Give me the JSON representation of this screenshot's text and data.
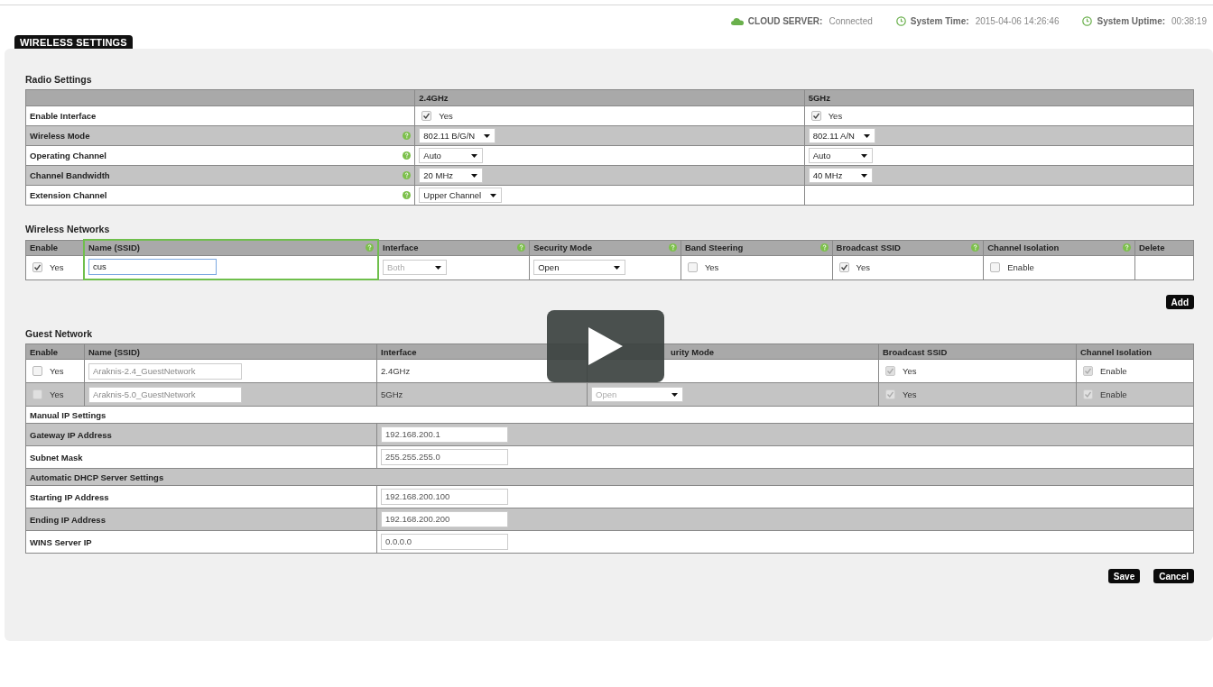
{
  "page_title": "WIRELESS SETTINGS",
  "status_bar": [
    {
      "kind": "cloud",
      "label": "CLOUD SERVER:",
      "value": "Connected"
    },
    {
      "kind": "clock",
      "label": "System Time:",
      "value": "2015-04-06 14:26:46"
    },
    {
      "kind": "clock",
      "label": "System Uptime:",
      "value": "00:38:19"
    }
  ],
  "radio_settings": {
    "title": "Radio Settings",
    "columns": [
      "2.4GHz",
      "5GHz"
    ],
    "rows": [
      {
        "label": "Enable Interface",
        "help": false,
        "kind": "checkbox",
        "cells": [
          {
            "checked": true,
            "text": "Yes"
          },
          {
            "checked": true,
            "text": "Yes"
          }
        ]
      },
      {
        "label": "Wireless Mode",
        "help": true,
        "kind": "select",
        "cells": [
          {
            "value": "802.11 B/G/N"
          },
          {
            "value": "802.11 A/N"
          }
        ]
      },
      {
        "label": "Operating Channel",
        "help": true,
        "kind": "select",
        "cells": [
          {
            "value": "Auto"
          },
          {
            "value": "Auto"
          }
        ]
      },
      {
        "label": "Channel Bandwidth",
        "help": true,
        "kind": "select",
        "cells": [
          {
            "value": "20 MHz"
          },
          {
            "value": "40 MHz"
          }
        ]
      },
      {
        "label": "Extension Channel",
        "help": true,
        "kind": "select",
        "cells": [
          {
            "value": "Upper Channel"
          }
        ]
      }
    ]
  },
  "wireless_networks": {
    "title": "Wireless Networks",
    "columns": [
      {
        "label": "Enable",
        "help": false,
        "highlighted": false
      },
      {
        "label": "Name (SSID)",
        "help": true,
        "highlighted": true
      },
      {
        "label": "Interface",
        "help": true,
        "highlighted": false
      },
      {
        "label": "Security Mode",
        "help": true,
        "highlighted": false
      },
      {
        "label": "Band Steering",
        "help": true,
        "highlighted": false
      },
      {
        "label": "Broadcast SSID",
        "help": true,
        "highlighted": false
      },
      {
        "label": "Channel Isolation",
        "help": true,
        "highlighted": false
      },
      {
        "label": "Delete",
        "help": false,
        "highlighted": false
      }
    ],
    "rows": [
      {
        "enabled": true,
        "enable_label": "Yes",
        "name": "cus",
        "interface": "Both",
        "interface_disabled": true,
        "security_mode": "Open",
        "band_steering": false,
        "band_steering_label": "Yes",
        "broadcast": true,
        "broadcast_label": "Yes",
        "isolation": false,
        "isolation_label": "Enable"
      }
    ],
    "add_button": "Add"
  },
  "guest_network": {
    "title": "Guest Network",
    "columns": [
      "Enable",
      "Name (SSID)",
      "Interface",
      "urity Mode",
      "Broadcast SSID",
      "Channel Isolation"
    ],
    "rows": [
      {
        "enabled": false,
        "enable_disabled": false,
        "enable_label": "Yes",
        "name": "Araknis-2.4_GuestNetwork",
        "interface": "2.4GHz",
        "broadcast": true,
        "broadcast_label": "Yes",
        "isolation": true,
        "isolation_label": "Enable"
      },
      {
        "enabled": false,
        "enable_disabled": true,
        "enable_label": "Yes",
        "name": "Araknis-5.0_GuestNetwork",
        "interface": "5GHz",
        "security_mode": "Open",
        "broadcast": true,
        "broadcast_label": "Yes",
        "isolation": true,
        "isolation_label": "Enable"
      }
    ],
    "settings": [
      {
        "kind": "section",
        "label": "Manual IP Settings"
      },
      {
        "kind": "field",
        "label": "Gateway IP Address",
        "value": "192.168.200.1"
      },
      {
        "kind": "field",
        "label": "Subnet Mask",
        "value": "255.255.255.0"
      },
      {
        "kind": "section",
        "label": "Automatic DHCP Server Settings"
      },
      {
        "kind": "field",
        "label": "Starting IP Address",
        "value": "192.168.200.100"
      },
      {
        "kind": "field",
        "label": "Ending IP Address",
        "value": "192.168.200.200"
      },
      {
        "kind": "field",
        "label": "WINS Server IP",
        "value": "0.0.0.0"
      }
    ]
  },
  "buttons": [
    "Save",
    "Cancel"
  ]
}
